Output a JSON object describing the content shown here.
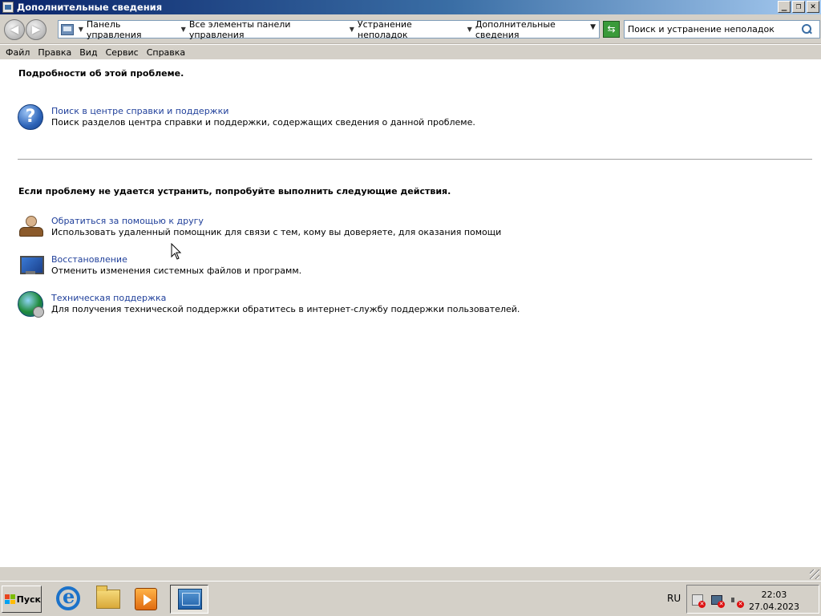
{
  "window": {
    "title": "Дополнительные сведения",
    "controls": {
      "minimize": "_",
      "maximize": "❐",
      "close": "✕"
    }
  },
  "navbar": {
    "breadcrumbs": [
      "Панель управления",
      "Все элементы панели управления",
      "Устранение неполадок",
      "Дополнительные сведения"
    ],
    "search_value": "Поиск и устранение неполадок"
  },
  "menu": [
    "Файл",
    "Правка",
    "Вид",
    "Сервис",
    "Справка"
  ],
  "content": {
    "section1_heading": "Подробности об этой проблеме.",
    "help_task": {
      "link": "Поиск в центре справки и поддержки",
      "desc": "Поиск разделов центра справки и поддержки, содержащих сведения о данной проблеме."
    },
    "section2_heading": "Если проблему не удается устранить, попробуйте выполнить следующие действия.",
    "tasks": [
      {
        "link": "Обратиться за помощью к другу",
        "desc": "Использовать удаленный помощник для связи с тем, кому вы доверяете, для оказания помощи"
      },
      {
        "link": "Восстановление",
        "desc": "Отменить изменения системных файлов и программ."
      },
      {
        "link": "Техническая поддержка",
        "desc": "Для получения технической поддержки обратитесь в интернет-службу поддержки пользователей."
      }
    ]
  },
  "taskbar": {
    "start_label": "Пуск",
    "language": "RU",
    "time": "22:03",
    "date": "27.04.2023"
  },
  "colors": {
    "link": "#1f3f9a",
    "chrome": "#d4d0c8",
    "title_gradient_start": "#0a246a"
  }
}
